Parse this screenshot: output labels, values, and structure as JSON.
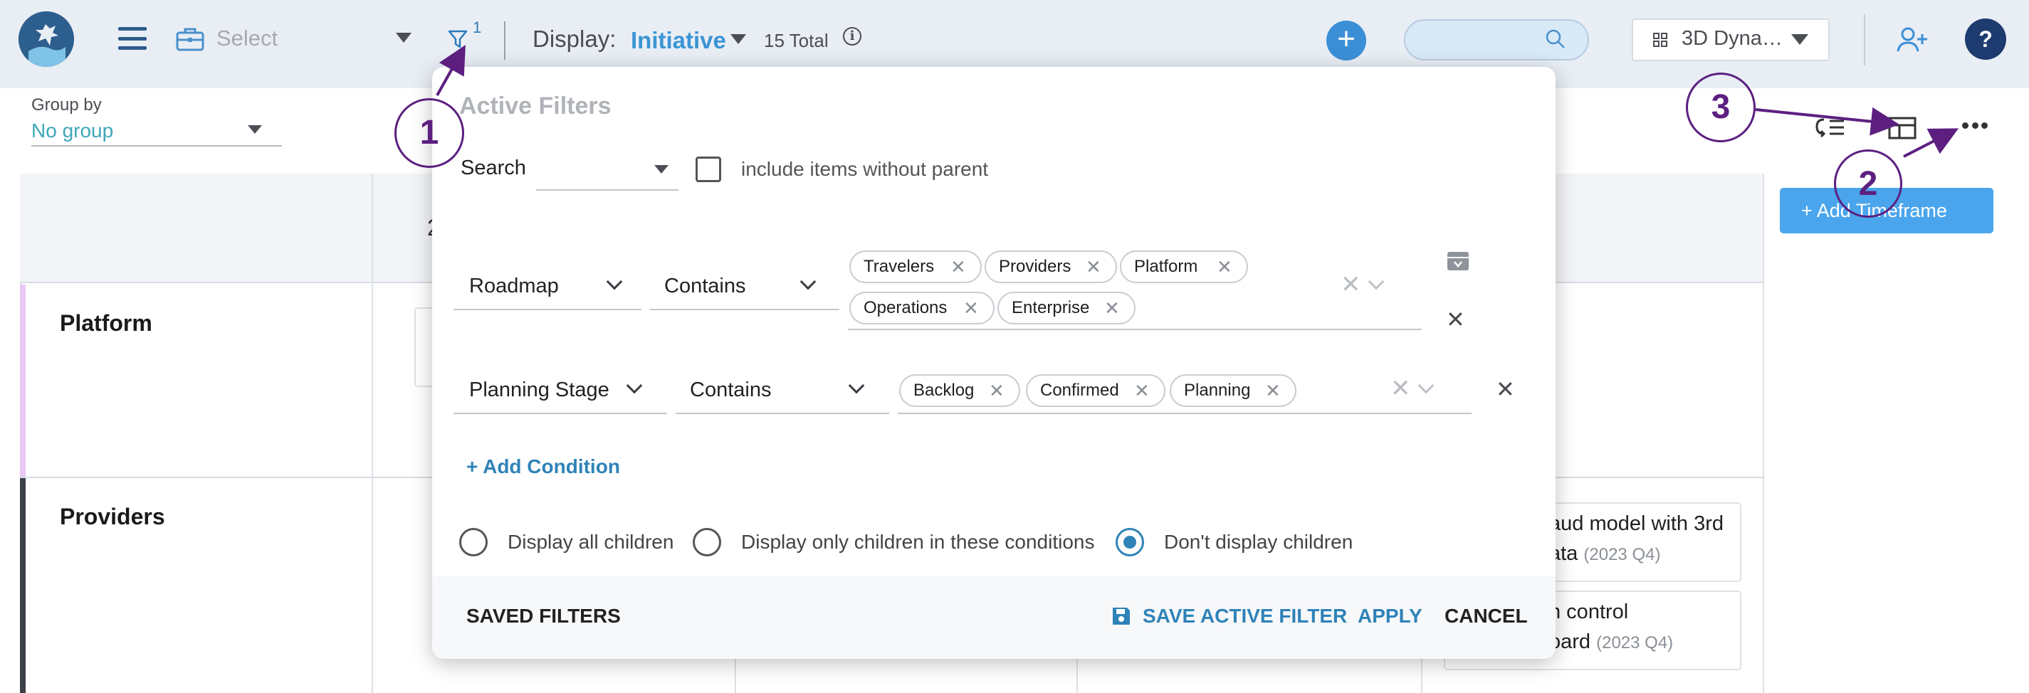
{
  "topbar": {
    "select_label": "Select",
    "filter_count": "1",
    "display_label": "Display:",
    "display_value": "Initiative",
    "total_text": "15 Total",
    "info_glyph": "i",
    "add_glyph": "+",
    "search_placeholder": "",
    "view_label": "3D Dyna…",
    "help_glyph": "?"
  },
  "toolbar": {
    "group_by_label": "Group by",
    "group_by_value": "No group",
    "add_timeframe": "+ Add Timeframe"
  },
  "board": {
    "header_fragment": "2",
    "lanes": [
      {
        "label": "Platform",
        "color": "#e9c8f5"
      },
      {
        "label": "Providers",
        "color": "#3a3f48"
      }
    ],
    "cards": [
      {
        "line1": "aud model with 3rd",
        "line2": "ata",
        "date": "(2023 Q4)"
      },
      {
        "line1": "n control",
        "line2": "oard",
        "date": "(2023 Q4)"
      }
    ]
  },
  "modal": {
    "title": "Active Filters",
    "search_label": "Search",
    "include_label": "include items without parent",
    "conditions": [
      {
        "field": "Roadmap",
        "operator": "Contains",
        "values": [
          "Travelers",
          "Providers",
          "Platform",
          "Operations",
          "Enterprise"
        ]
      },
      {
        "field": "Planning Stage",
        "operator": "Contains",
        "values": [
          "Backlog",
          "Confirmed",
          "Planning"
        ]
      }
    ],
    "add_condition": "+ Add Condition",
    "radio_options": [
      {
        "label": "Display all children",
        "selected": false
      },
      {
        "label": "Display only children in these conditions",
        "selected": false
      },
      {
        "label": "Don't display children",
        "selected": true
      }
    ],
    "saved_filters": "SAVED FILTERS",
    "save_active_filter": "SAVE ACTIVE FILTER",
    "apply": "APPLY",
    "cancel": "CANCEL",
    "remove_glyph": "✕",
    "chip_remove_glyph": "✕"
  },
  "annotations": [
    {
      "number": "1"
    },
    {
      "number": "2"
    },
    {
      "number": "3"
    }
  ],
  "colors": {
    "accent": "#2f83b8",
    "annotation": "#5c1f80",
    "topbar_bg": "#e9eef5",
    "primary_button": "#3b8fd6"
  },
  "icons": [
    "app-logo-icon",
    "hamburger-menu-icon",
    "briefcase-icon",
    "filter-funnel-icon",
    "info-icon",
    "plus-icon",
    "search-icon",
    "grid-icon",
    "add-user-icon",
    "help-icon",
    "collapse-list-icon",
    "layout-icon",
    "more-dots-icon",
    "archive-icon",
    "save-floppy-icon"
  ]
}
